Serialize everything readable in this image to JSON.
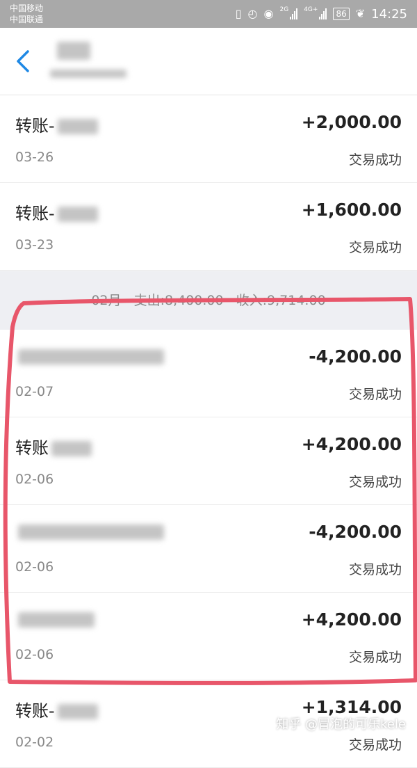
{
  "status_bar": {
    "carrier_1": "中国移动",
    "carrier_2": "中国联通",
    "net_1": "2G",
    "net_2": "4G+",
    "battery": "86",
    "time": "14:25"
  },
  "month_header": {
    "month": "02月",
    "expense": "支出:8,400.00",
    "income": "收入:9,714.00"
  },
  "transactions_march": [
    {
      "name": "转账-",
      "amount": "+2,000.00",
      "date": "03-26",
      "status": "交易成功"
    },
    {
      "name": "转账-",
      "amount": "+1,600.00",
      "date": "03-23",
      "status": "交易成功"
    }
  ],
  "transactions_feb": [
    {
      "name": "",
      "amount": "-4,200.00",
      "date": "02-07",
      "status": "交易成功"
    },
    {
      "name": "转账",
      "amount": "+4,200.00",
      "date": "02-06",
      "status": "交易成功"
    },
    {
      "name": "",
      "amount": "-4,200.00",
      "date": "02-06",
      "status": "交易成功"
    },
    {
      "name": "",
      "amount": "+4,200.00",
      "date": "02-06",
      "status": "交易成功"
    },
    {
      "name": "转账-",
      "amount": "+1,314.00",
      "date": "02-02",
      "status": "交易成功"
    }
  ],
  "watermark": "知乎 @冒泡的可乐kele",
  "colors": {
    "accent": "#1e88e5",
    "highlight_stroke": "#e8566a"
  }
}
